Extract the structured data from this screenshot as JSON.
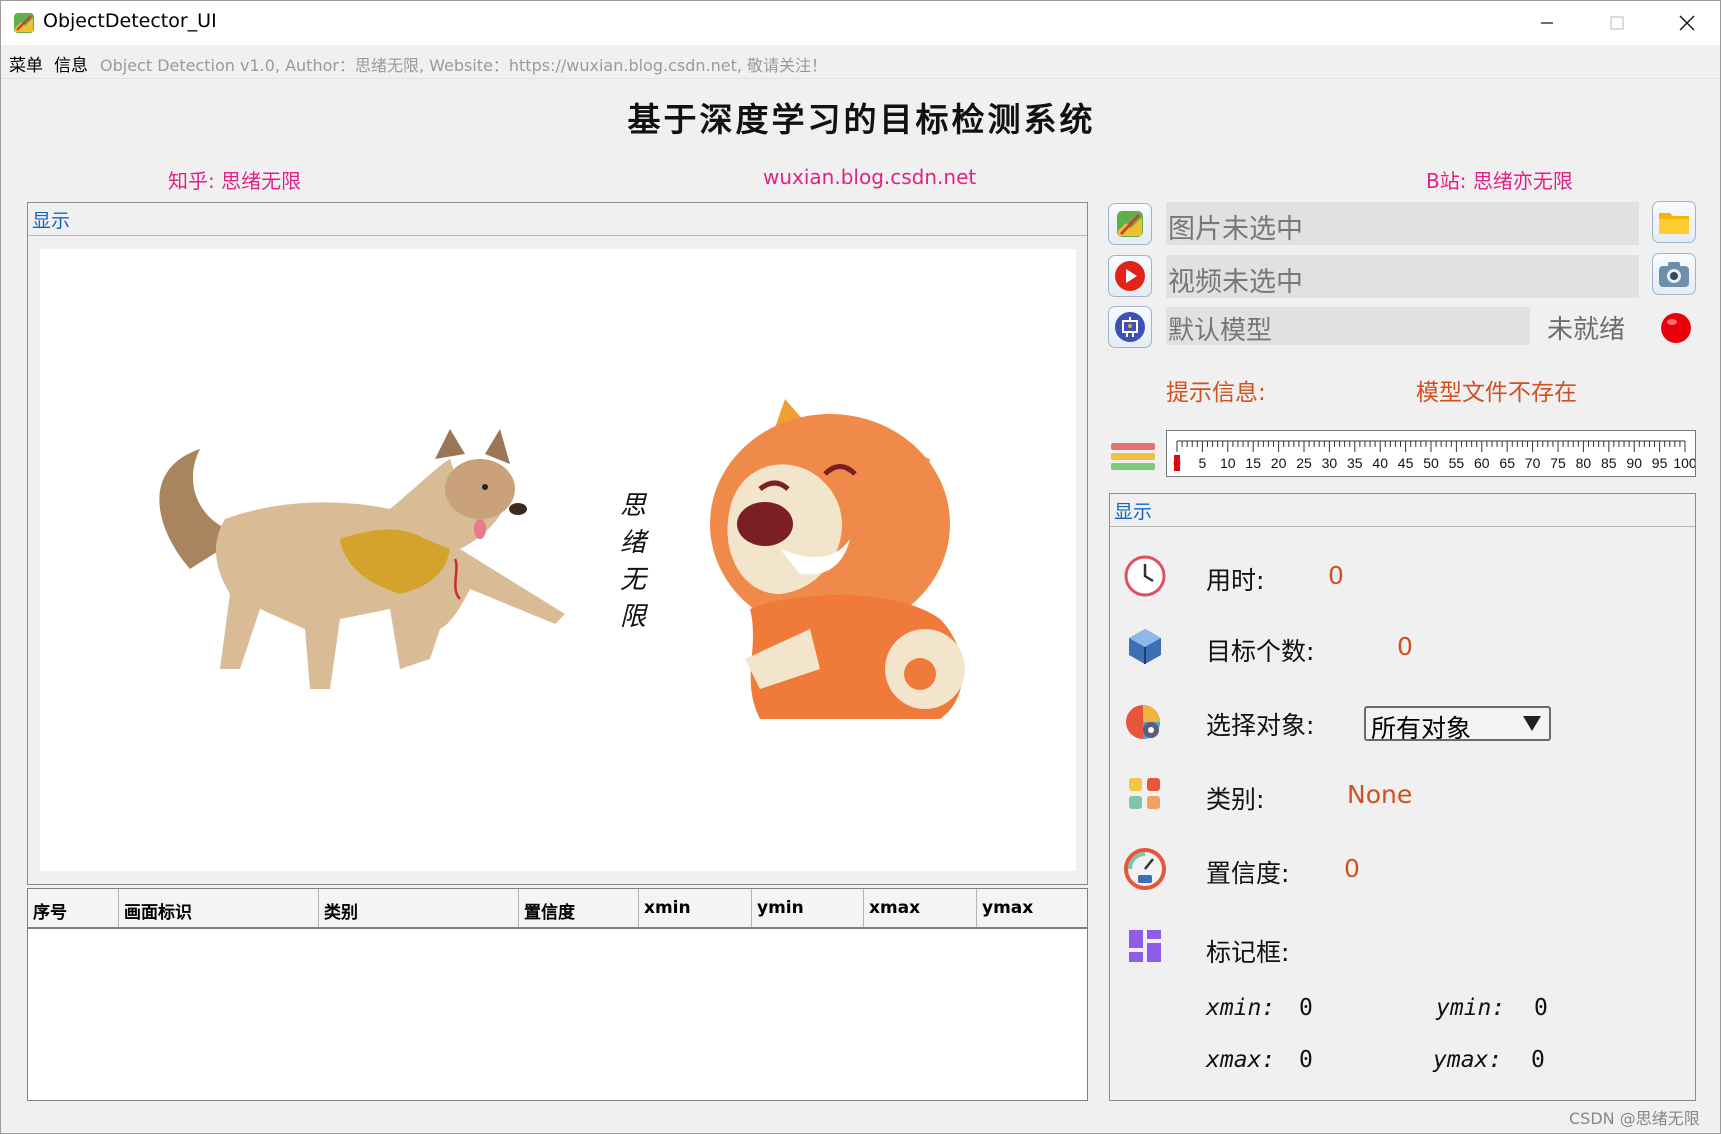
{
  "window": {
    "title": "ObjectDetector_UI"
  },
  "menubar": {
    "menu": "菜单",
    "info": "信息",
    "info_text": "Object Detection v1.0, Author：思绪无限, Website：https://wuxian.blog.csdn.net, 敬请关注！"
  },
  "header": {
    "title": "基于深度学习的目标检测系统",
    "zhihu": "知乎: 思绪无限",
    "website": "wuxian.blog.csdn.net",
    "bilibili": "B站: 思绪亦无限"
  },
  "left_group": {
    "title": "显示",
    "image_caption": "思绪无限"
  },
  "table": {
    "columns": [
      "序号",
      "画面标识",
      "类别",
      "置信度",
      "xmin",
      "ymin",
      "xmax",
      "ymax"
    ]
  },
  "controls": {
    "image_field": "图片未选中",
    "video_field": "视频未选中",
    "model_field": "默认模型",
    "model_status": "未就绪",
    "tip_label": "提示信息:",
    "tip_message": "模型文件不存在"
  },
  "slider": {
    "value": 0,
    "min": 0,
    "max": 100,
    "labels": [
      "0",
      "5",
      "10",
      "15",
      "20",
      "25",
      "30",
      "35",
      "40",
      "45",
      "50",
      "55",
      "60",
      "65",
      "70",
      "75",
      "80",
      "85",
      "90",
      "95",
      "100"
    ]
  },
  "result_group": {
    "title": "显示",
    "time_label": "用时:",
    "time_value": "0",
    "count_label": "目标个数:",
    "count_value": "0",
    "select_label": "选择对象:",
    "select_value": "所有对象",
    "class_label": "类别:",
    "class_value": "None",
    "conf_label": "置信度:",
    "conf_value": "0",
    "box_label": "标记框:",
    "xmin_label": "xmin:",
    "xmin_value": "0",
    "ymin_label": "ymin:",
    "ymin_value": "0",
    "xmax_label": "xmax:",
    "xmax_value": "0",
    "ymax_label": "ymax:",
    "ymax_value": "0"
  },
  "watermark": "CSDN @思绪无限",
  "colors": {
    "accent_pink": "#e0218a",
    "accent_orange": "#d2501f",
    "group_title": "#1565c0",
    "status_red": "#e8000b"
  }
}
